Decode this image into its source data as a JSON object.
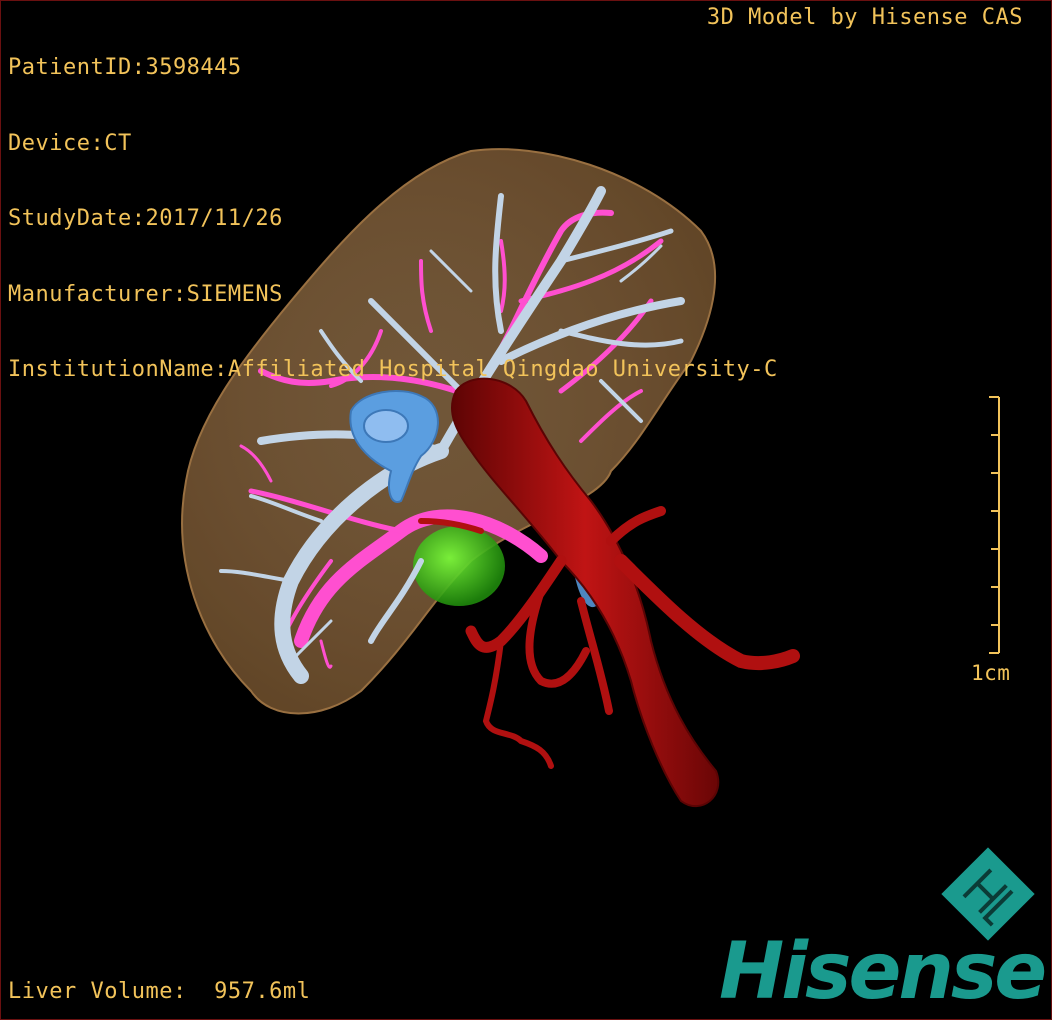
{
  "patient_info": {
    "patient_id": "PatientID:3598445",
    "device": "Device:CT",
    "study_date": "StudyDate:2017/11/26",
    "manufacturer": "Manufacturer:SIEMENS",
    "institution": "InstitutionName:Affiliated Hospital Qingdao University-C"
  },
  "brand_label": "3D Model by Hisense CAS",
  "liver_volume": "Liver Volume:  957.6ml",
  "scale_bar": {
    "label": "1cm"
  },
  "logo": {
    "wordmark": "Hisense",
    "monogram": "HL"
  },
  "colors": {
    "overlay_text": "#f2c35a",
    "liver": "#c9945a",
    "hepatic_vein": "#b9cde0",
    "portal_vein": "#ff4fd0",
    "artery_aorta": "#a80f0f",
    "tumor": "#3ec21a",
    "ivc": "#5b9ee0",
    "logo": "#1a9a8e"
  }
}
